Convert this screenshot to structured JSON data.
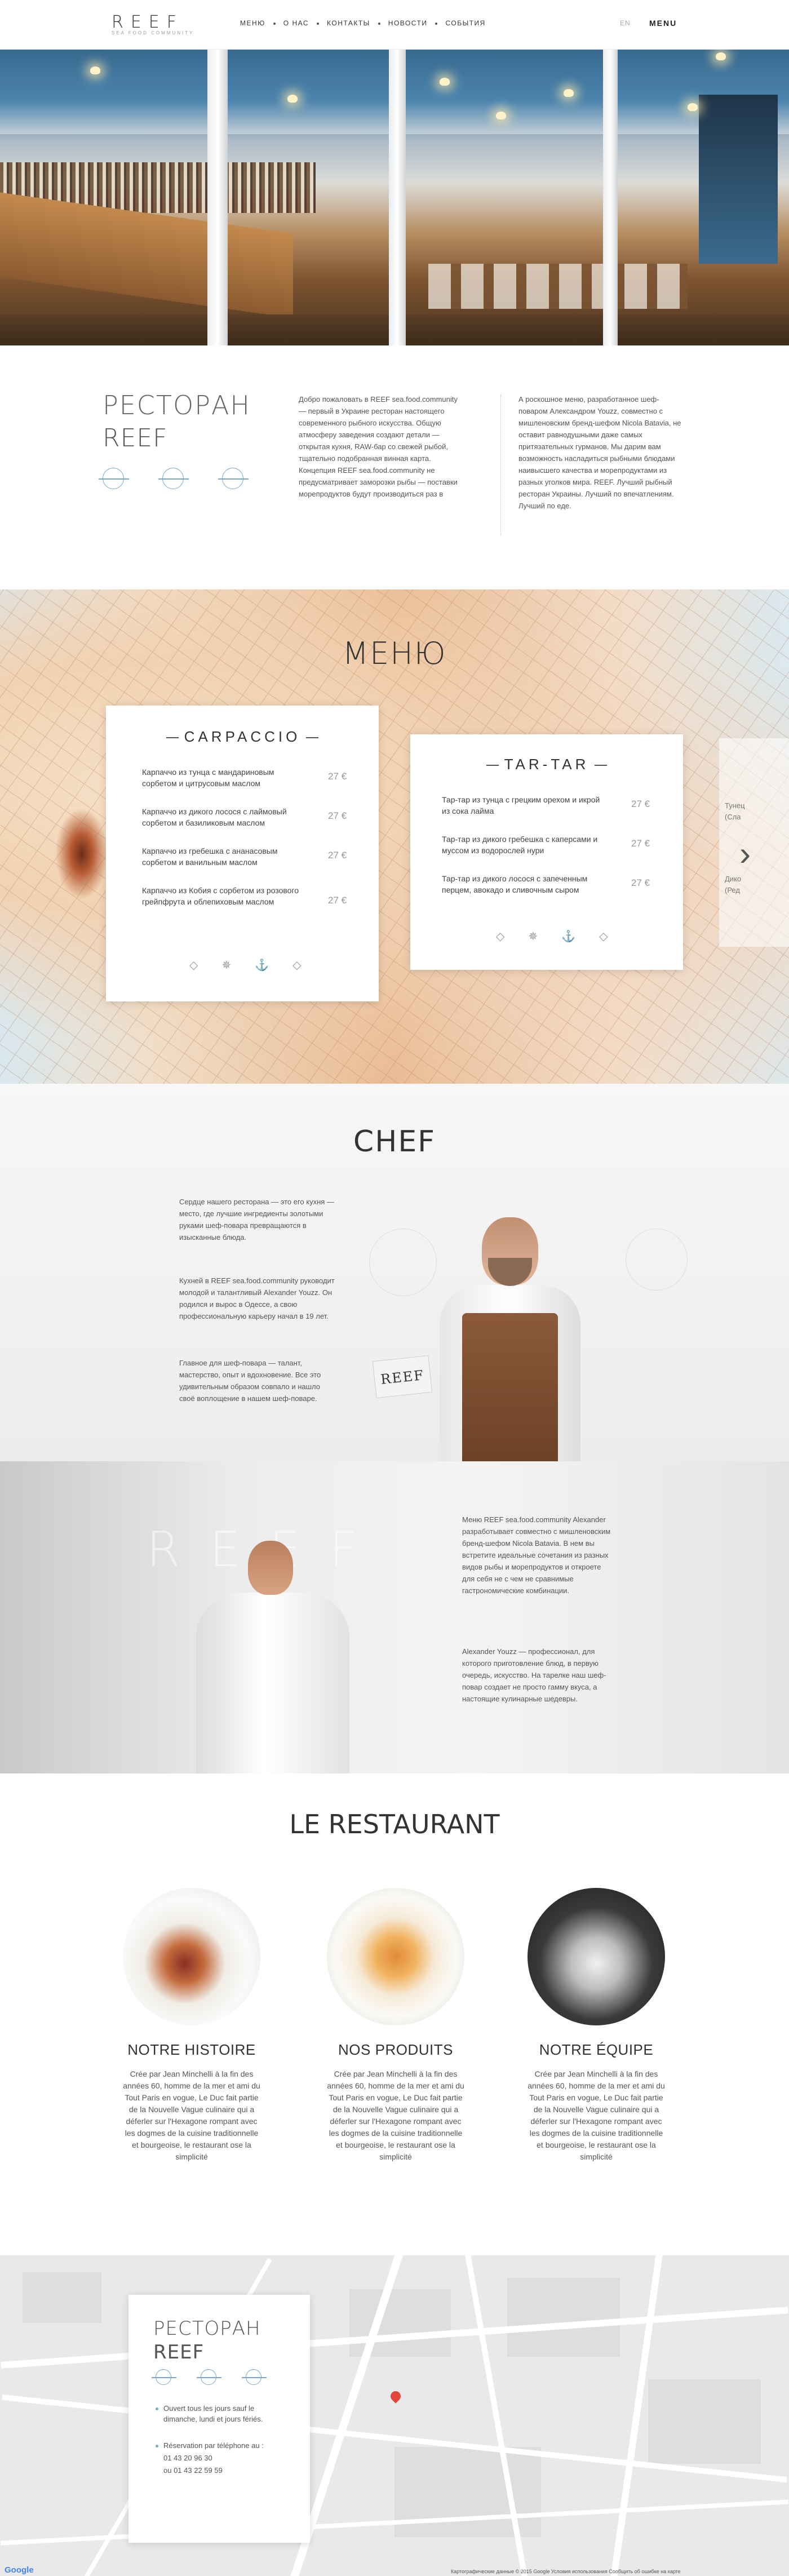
{
  "header": {
    "logo": "REEF",
    "logo_sub": "SEA FOOD COMMUNITY",
    "nav": [
      "МЕНЮ",
      "О НАС",
      "КОНТАКТЫ",
      "НОВОСТИ",
      "СОБЫТИЯ"
    ],
    "lang": "EN",
    "menu_button": "MENU"
  },
  "intro": {
    "title_line1": "РЕСТОРАН",
    "title_line2": "REEF",
    "col1": "Добро пожаловать в REEF sea.food.community — первый в Украине ресторан настоящего современного рыбного искусства. Общую атмосферу заведения создают детали — открытая кухня, RAW-бар со свежей рыбой, тщательно подобранная винная карта. Концепция REEF sea.food.community не предусматривает заморозки рыбы — поставки морепродуктов будут производиться раз в",
    "col2": "А роскошное меню, разработанное шеф-поваром Александром Youzz, совместно с мишленовским бренд-шефом Nicola Batavia, не оставит равнодушными даже самых притязательных гурманов. Мы дарим вам возможность насладиться рыбными блюдами наивысшего качества и морепродуктами из разных уголков мира. REEF. Лучший рыбный ресторан Украины. Лучший по впечатлениям. Лучший по еде."
  },
  "menu": {
    "title": "МЕНЮ",
    "card1": {
      "title": "CARPACCIO",
      "items": [
        {
          "name": "Карпаччо из тунца с мандариновым сорбетом и цитрусовым маслом",
          "price": "27 €"
        },
        {
          "name": "Карпаччо из дикого лосося с лаймовый сорбетом и базиликовым маслом",
          "price": "27 €"
        },
        {
          "name": "Карпаччо из гребешка с ананасовым сорбетом и ванильным маслом",
          "price": "27 €"
        },
        {
          "name": "Карпаччо из Кобия с сорбетом из розового грейпфрута и облепиховым маслом",
          "price": "27 €"
        }
      ]
    },
    "card2": {
      "title": "TAR-TAR",
      "items": [
        {
          "name": "Тар-тар из тунца с грецким орехом и икрой из сока лайма",
          "price": "27 €"
        },
        {
          "name": "Тар-тар из дикого гребешка с каперсами и муссом из водорослей нури",
          "price": "27 €"
        },
        {
          "name": "Тар-тар из дикого лосося с запеченным перцем, авокадо и сливочным сыром",
          "price": "27 €"
        }
      ]
    },
    "card3": {
      "lines": [
        "Тунец",
        "(Сла",
        "Дико",
        "(Ред"
      ]
    },
    "icons": [
      "◇",
      "✵",
      "⚓",
      "◇"
    ],
    "next_arrow": "›"
  },
  "chef": {
    "title": "CHEF",
    "p1": "Сердце нашего ресторана — это его кухня — место, где лучшие ингредиенты золотыми руками шеф-повара превращаются в изысканные блюда.",
    "p2": "Кухней в REEF sea.food.community руководит молодой и талантливый Alexander Youzz. Он родился и вырос в Одессе, а свою профессиональную карьеру начал в 19 лет.",
    "p3": "Главное для шеф-повара — талант, мастерство, опыт и вдохновение. Все это удивительным образом совпало и нашло своё воплощение в нашем шеф-поваре.",
    "sign": "REEF"
  },
  "chef2": {
    "ghost": "REEF",
    "p1": "Меню REEF sea.food.community Alexander разработывает совместно с мишленовским бренд-шефом Nicola Batavia. В нем вы встретите идеальные сочетания из разных видов рыбы и морепродуктов и откроете для себя не с чем не сравнимые гастрономические комбинации.",
    "p2": "Alexander Youzz — профессионал, для которого приготовление блюд, в первую очередь, искусство. На тарелке наш шеф-повар создает не просто гамму вкуса, а настоящие кулинарные шедевры."
  },
  "le_restaurant": {
    "title": "LE RESTAURANT",
    "items": [
      {
        "heading": "NOTRE HISTOIRE",
        "text": "Crée par Jean Minchelli à la fin des années 60, homme de la mer et ami du Tout Paris en vogue, Le Duc fait partie de la Nouvelle Vague culinaire qui a déferler sur l'Hexagone rompant avec les dogmes de la cuisine traditionnelle et bourgeoise, le restaurant ose la simplicité"
      },
      {
        "heading": "NOS PRODUITS",
        "text": "Crée par Jean Minchelli à la fin des années 60, homme de la mer et ami du Tout Paris en vogue, Le Duc fait partie de la Nouvelle Vague culinaire qui a déferler sur l'Hexagone rompant avec les dogmes de la cuisine traditionnelle et bourgeoise, le restaurant ose la simplicité"
      },
      {
        "heading": "NOTRE ÉQUIPE",
        "text": "Crée par Jean Minchelli à la fin des années 60, homme de la mer et ami du Tout Paris en vogue, Le Duc fait partie de la Nouvelle Vague culinaire qui a déferler sur l'Hexagone rompant avec les dogmes de la cuisine traditionnelle et bourgeoise, le restaurant ose la simplicité"
      }
    ]
  },
  "contact": {
    "title_line1": "РЕСТОРАН",
    "title_line2": "REEF",
    "hours_line1": "Ouvert tous les jours sauf le",
    "hours_line2": "dimanche, lundi et jours fériés.",
    "phone_label": "Réservation par téléphone au :",
    "phone1": "01 43 20 96 30",
    "phone2": "ou 01 43 22 59 59"
  },
  "map": {
    "google": "Google",
    "footer": "Картографические данные © 2015 Google   Условия использования   Сообщить об ошибке на карте"
  }
}
